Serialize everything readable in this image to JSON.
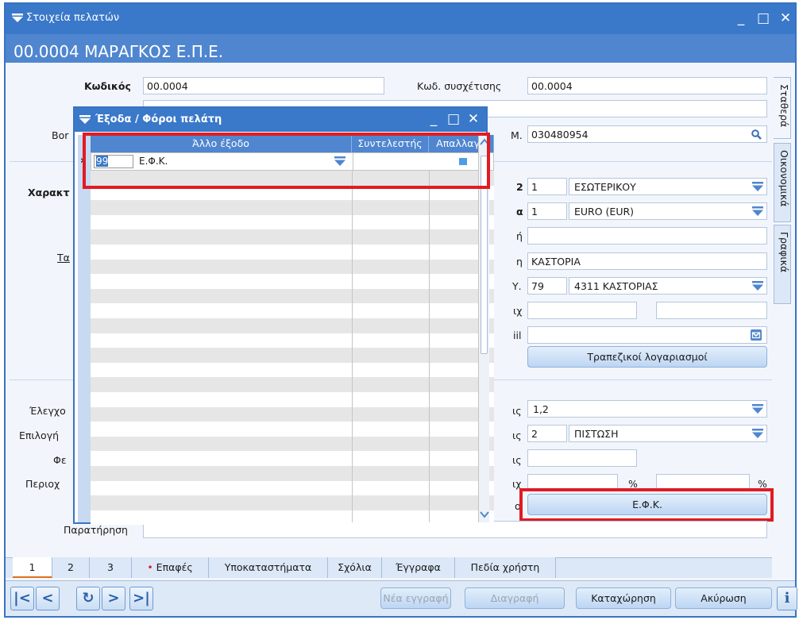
{
  "window": {
    "title": "Στοιχεία πελατών",
    "minimize": "_",
    "maximize": "□",
    "close": "✕"
  },
  "header": {
    "title": "00.0004 ΜΑΡΑΓΚΟΣ Ε.Π.Ε."
  },
  "form": {
    "code_label": "Κωδικός",
    "code_value": "00.0004",
    "assoc_label": "Κωδ. συσχέτισης",
    "assoc_value": "00.0004",
    "partial_label_bor": "Bor",
    "partial_label_afm": "Μ.",
    "afm_value": "030480954",
    "partial_label_charakt": "Χαρακτ",
    "pl2": "2",
    "cat_code": "1",
    "cat_value": "ΕΣΩΤΕΡΙΚΟΥ",
    "pla": "α",
    "cur_code": "1",
    "cur_value": "EURO (EUR)",
    "pl_i": "ή",
    "partial_label_t": "Τα",
    "pl_city": "η",
    "city_value": "ΚΑΣΤΟΡΙΑ",
    "pl_y": "Υ.",
    "doy_code": "79",
    "doy_value": "4311 ΚΑΣΤΟΡΙΑΣ",
    "pl_ix": "ιχ",
    "pl_il": "iil",
    "bank_button": "Τραπεζικοί λογαριασμοί",
    "partial_label_elegx": "Έλεγχο",
    "pl_is1": "ις",
    "check_value": "1,2",
    "partial_label_epilogi": "Επιλογή",
    "pl_is2": "ις",
    "pay_code": "2",
    "pay_value": "ΠΙΣΤΩΣΗ",
    "partial_label_fe": "Φε",
    "pl_is3": "ις",
    "partial_label_periox": "Περιοχ",
    "pl_ix2": "ιχ",
    "percent1": "%",
    "percent2": "%",
    "pl_o": "ο",
    "efk_button": "Ε.Φ.Κ.",
    "notes_label": "Παρατήρηση"
  },
  "side_tabs": [
    "Σταθερά",
    "Οικονομικά",
    "Γραφικά"
  ],
  "bottom_tabs": [
    "1",
    "2",
    "3",
    "Επαφές",
    "Υποκαταστήματα",
    "Σχόλια",
    "Έγγραφα",
    "Πεδία χρήστη"
  ],
  "bottom_tab_bullet": "•",
  "toolbar": {
    "first": "|<",
    "prev": "<",
    "refresh": "↻",
    "next": ">",
    "last": ">|",
    "new_record": "Νέα εγγραφή",
    "delete": "Διαγραφή",
    "save": "Καταχώρηση",
    "cancel": "Ακύρωση",
    "info": "i"
  },
  "dialog": {
    "title": "Έξοδα / Φόροι πελάτη",
    "minimize": "_",
    "maximize": "□",
    "close": "✕",
    "columns": [
      "Άλλο έξοδο",
      "Συντελεστής",
      "Απαλλαγή"
    ],
    "row_indicator": "›",
    "rows": [
      {
        "code": "99",
        "name": "Ε.Φ.Κ.",
        "rate": "",
        "exempt": true
      }
    ]
  },
  "colors": {
    "accent": "#3a78c9",
    "header": "#4f86cf",
    "highlight": "#e01b24"
  }
}
